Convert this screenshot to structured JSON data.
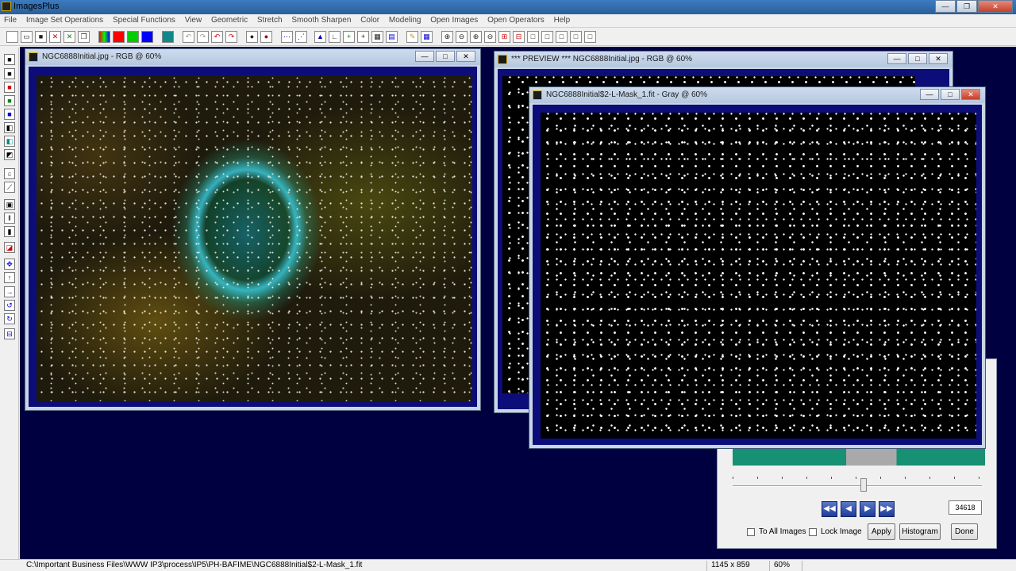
{
  "app": {
    "title": "ImagesPlus"
  },
  "menu": [
    "File",
    "Image Set Operations",
    "Special Functions",
    "View",
    "Geometric",
    "Stretch",
    "Smooth Sharpen",
    "Color",
    "Modeling",
    "Open Images",
    "Open Operators",
    "Help"
  ],
  "windows": {
    "initial": {
      "title": "NGC6888Initial.jpg - RGB @ 60%"
    },
    "preview": {
      "title": "*** PREVIEW *** NGC6888Initial.jpg - RGB @ 60%"
    },
    "mask": {
      "title": "NGC6888Initial$2-L-Mask_1.fit - Gray @ 60%"
    }
  },
  "panel": {
    "value": "34618",
    "to_all_images": "To All Images",
    "lock_image": "Lock Image",
    "apply": "Apply",
    "histogram": "Histogram",
    "done": "Done",
    "nav_first": "◀◀",
    "nav_prev": "◀",
    "nav_next": "▶",
    "nav_last": "▶▶"
  },
  "status": {
    "path": "C:\\Important Business Files\\WWW IP3\\process\\IP5\\PH-BAFIME\\NGC6888Initial$2-L-Mask_1.fit",
    "dimensions": "1145 x 859",
    "zoom": "60%"
  },
  "colors": {
    "mdi_background": "#000040",
    "client_frame": "#0d0d7a",
    "histogram_green": "#169173"
  }
}
